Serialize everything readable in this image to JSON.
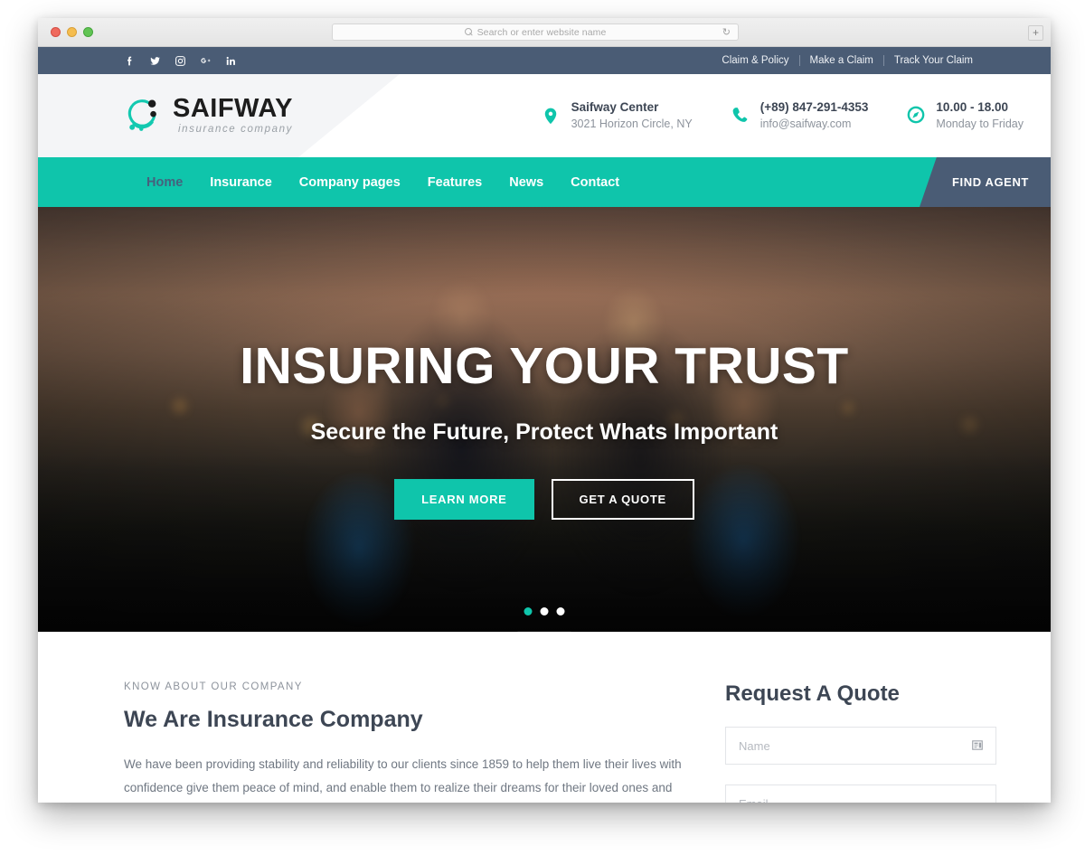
{
  "browser": {
    "search_placeholder": "Search or enter website name",
    "reload_glyph": "↻",
    "newtab_glyph": "+"
  },
  "topbar": {
    "social": [
      {
        "name": "facebook-icon",
        "label": "f"
      },
      {
        "name": "twitter-icon",
        "label": "t"
      },
      {
        "name": "instagram-icon",
        "label": "ig"
      },
      {
        "name": "google-plus-icon",
        "label": "G+"
      },
      {
        "name": "linkedin-icon",
        "label": "in"
      }
    ],
    "links": [
      "Claim & Policy",
      "Make a Claim",
      "Track Your Claim"
    ]
  },
  "header": {
    "logo_name": "SAIFWAY",
    "logo_tagline": "insurance company",
    "contacts": [
      {
        "icon": "location-pin-icon",
        "title": "Saifway Center",
        "sub": "3021 Horizon Circle, NY"
      },
      {
        "icon": "phone-icon",
        "title": "(+89) 847-291-4353",
        "sub": "info@saifway.com"
      },
      {
        "icon": "clock-icon",
        "title": "10.00 - 18.00",
        "sub": "Monday to Friday"
      }
    ]
  },
  "nav": {
    "items": [
      {
        "label": "Home",
        "active": true
      },
      {
        "label": "Insurance",
        "active": false
      },
      {
        "label": "Company pages",
        "active": false
      },
      {
        "label": "Features",
        "active": false
      },
      {
        "label": "News",
        "active": false
      },
      {
        "label": "Contact",
        "active": false
      }
    ],
    "cta_label": "FIND AGENT"
  },
  "hero": {
    "title": "INSURING YOUR TRUST",
    "subtitle": "Secure the Future, Protect Whats Important",
    "primary_button": "LEARN MORE",
    "secondary_button": "GET A QUOTE",
    "slides_total": 3,
    "active_slide": 1
  },
  "about": {
    "eyebrow": "KNOW ABOUT OUR COMPANY",
    "title": "We Are Insurance Company",
    "body": "We have been providing stability and reliability to our clients since 1859 to help them live their lives with confidence give them peace of mind, and enable them to realize their dreams for their loved ones and their legacy. We have providing stability and reliability to our clients since 1859 to help them live their lives with confidence, to give them peace of"
  },
  "quote": {
    "title": "Request A Quote",
    "fields": [
      {
        "name": "name-field",
        "placeholder": "Name",
        "value": "",
        "icon": "contact-card-icon"
      },
      {
        "name": "email-field",
        "placeholder": "Email",
        "value": "",
        "icon": ""
      }
    ]
  },
  "colors": {
    "accent_teal": "#0fc5ab",
    "dark_slate": "#4a5c75",
    "heading": "#3d4654",
    "body_text": "#6f7782"
  }
}
